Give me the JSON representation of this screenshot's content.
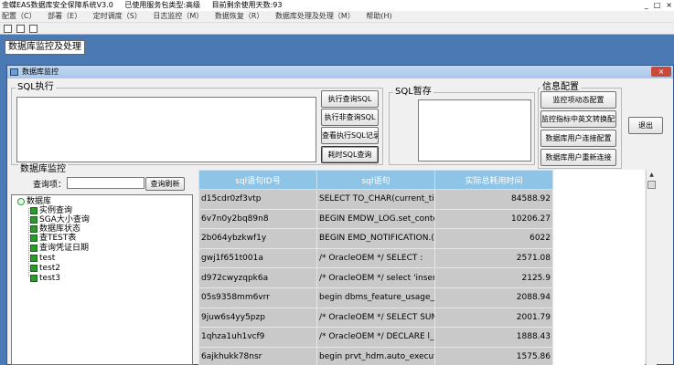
{
  "app": {
    "title_segments": [
      "金蝶EAS数据库安全保障系统V3.0",
      "已使用服务包类型:高级",
      "目前剩余使用天数:93"
    ],
    "window_controls": [
      "_",
      "□",
      "×"
    ]
  },
  "menu": [
    "配置（C）",
    "部署（E）",
    "定时调度（S）",
    "日志监控（M）",
    "数据恢复（R）",
    "数据库处理及处理（M）",
    "帮助(H)"
  ],
  "section_title": "数据库监控及处理",
  "window": {
    "title": "数据库监控",
    "close": "×"
  },
  "sql_exec": {
    "label": "SQL执行",
    "buttons": [
      "执行查询SQL",
      "执行非查询SQL",
      "查看执行SQL记录",
      "耗时SQL查询"
    ]
  },
  "sql_temp": {
    "label": "SQL暂存"
  },
  "info_config": {
    "label": "信息配置",
    "buttons": [
      "监控项动态配置",
      "监控指标中英文转换配置",
      "数据库用户连接配置",
      "数据库用户重新连接"
    ]
  },
  "exit_button": "退出",
  "db_monitor": {
    "label": "数据库监控",
    "query_label": "查询项：",
    "query_placeholder": "",
    "refresh_button": "查询刷新"
  },
  "tree": {
    "root": "数据库",
    "children": [
      "实例查询",
      "SGA大小查询",
      "数据库状态",
      "查TEST表",
      "查询凭证日期",
      "test",
      "test2",
      "test3"
    ]
  },
  "grid": {
    "headers": [
      "sql语句ID号",
      "sql语句",
      "实际总耗用时间"
    ],
    "rows": [
      [
        "d15cdr0zf3vtp",
        "SELECT TO_CHAR(current_tir",
        "84588.92"
      ],
      [
        "6v7n0y2bq89n8",
        "BEGIN EMDW_LOG.set_conte",
        "10206.27"
      ],
      [
        "2b064ybzkwf1y",
        "BEGIN EMD_NOTIFICATION.(",
        "6022"
      ],
      [
        "gwj1f651t001a",
        "/* OracleOEM */    SELECT :",
        "2571.08"
      ],
      [
        "d972cwyzqpk6a",
        "/* OracleOEM */  select 'insert_t",
        "2125.9"
      ],
      [
        "05s9358mm6vrr",
        "begin dbms_feature_usage_int",
        "2088.94"
      ],
      [
        "9juw6s4yy5pzp",
        "/* OracleOEM */  SELECT SUM",
        "2001.79"
      ],
      [
        "1qhza1uh1vcf9",
        "/* OracleOEM */  DECLARE  l_",
        "1888.43"
      ],
      [
        "6ajkhukk78nsr",
        "begin prvt_hdm.auto_execute(",
        "1575.86"
      ]
    ]
  }
}
